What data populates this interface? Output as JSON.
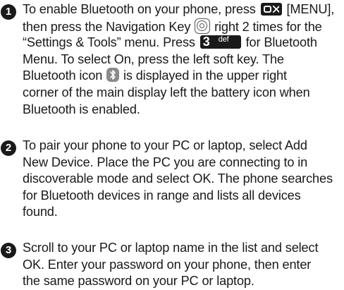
{
  "steps": [
    {
      "number": "1",
      "lines": {
        "l1_a": "To enable Bluetooth on your phone, press",
        "l1_b": "[MENU],",
        "l2_a": "then press the Navigation Key",
        "l2_b": "right 2 times for the",
        "l3_a": "“Settings & Tools” menu. Press",
        "l3_b": "for Bluetooth",
        "l4": "Menu. To select On, press the left soft key.  The",
        "l5_a": "Bluetooth icon",
        "l5_b": "is displayed in the upper right",
        "l6": "corner of the main display left the battery icon when",
        "l7": "Bluetooth is enabled."
      },
      "icons": {
        "ok_key": "ok-key-icon",
        "nav_key": "navigation-key-icon",
        "key3": "key-3-def-icon",
        "bluetooth": "bluetooth-icon"
      },
      "key3_digit": "3",
      "key3_letters": "def"
    },
    {
      "number": "2",
      "lines": {
        "l1": "To pair your phone to your PC or laptop, select Add",
        "l2": "New Device. Place the PC you are connecting to in",
        "l3": "discoverable mode and select OK. The phone searches",
        "l4": "for Bluetooth devices in range and lists all devices",
        "l5": "found."
      }
    },
    {
      "number": "3",
      "lines": {
        "l1": "Scroll to your PC or laptop name in the list and select",
        "l2": "OK. Enter your password on your phone, then enter",
        "l3": "the same password on your PC or laptop."
      }
    }
  ],
  "colors": {
    "text": "#1a1a1a",
    "icon_grey": "#8a8a8a"
  }
}
